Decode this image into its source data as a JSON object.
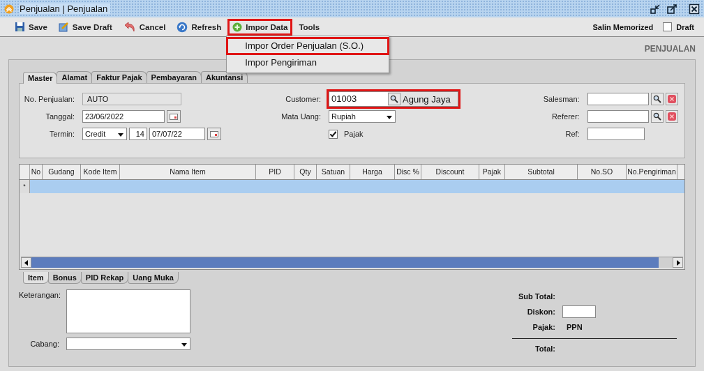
{
  "window": {
    "title": "Penjualan | Penjualan"
  },
  "toolbar": {
    "buttons": [
      {
        "kind": "save",
        "label": "Save",
        "highlighted": false
      },
      {
        "kind": "draft",
        "label": "Save Draft",
        "highlighted": false
      },
      {
        "kind": "cancel",
        "label": "Cancel",
        "highlighted": false
      },
      {
        "kind": "refresh",
        "label": "Refresh",
        "highlighted": false
      },
      {
        "kind": "import",
        "label": "Impor Data",
        "highlighted": true
      },
      {
        "kind": "plain",
        "label": "Tools",
        "highlighted": false
      }
    ],
    "memorized": "Salin Memorized",
    "draft": {
      "label": "Draft",
      "checked": false
    }
  },
  "menu": {
    "items": [
      {
        "label": "Impor Order Penjualan (S.O.)",
        "highlighted": true
      },
      {
        "label": "Impor Pengiriman",
        "highlighted": false
      }
    ]
  },
  "section_title": "PENJUALAN",
  "tabs": [
    {
      "label": "Master",
      "selected": true
    },
    {
      "label": "Alamat",
      "selected": false
    },
    {
      "label": "Faktur Pajak",
      "selected": false
    },
    {
      "label": "Pembayaran",
      "selected": false
    },
    {
      "label": "Akuntansi",
      "selected": false
    }
  ],
  "master": {
    "no_penjualan": {
      "label": "No. Penjualan:",
      "value": "AUTO"
    },
    "tanggal": {
      "label": "Tanggal:",
      "value": "23/06/2022"
    },
    "termin": {
      "label": "Termin:",
      "type": "Credit",
      "days": "14",
      "due": "07/07/22"
    },
    "customer": {
      "label": "Customer:",
      "code": "01003",
      "name": "Agung Jaya",
      "highlighted": true
    },
    "mata_uang": {
      "label": "Mata Uang:",
      "value": "Rupiah"
    },
    "pajak": {
      "label": "Pajak",
      "checked": true
    },
    "salesman": {
      "label": "Salesman:"
    },
    "referer": {
      "label": "Referer:"
    },
    "ref": {
      "label": "Ref:"
    }
  },
  "table": {
    "columns": [
      "No",
      "Gudang",
      "Kode Item",
      "Nama Item",
      "PID",
      "Qty",
      "Satuan",
      "Harga",
      "Disc %",
      "Discount",
      "Pajak",
      "Subtotal",
      "No.SO",
      "No.Pengiriman"
    ],
    "rows": [
      {
        "marker": "*",
        "selected": true
      }
    ]
  },
  "bottom_tabs": [
    {
      "label": "Item",
      "selected": true
    },
    {
      "label": "Bonus",
      "selected": false
    },
    {
      "label": "PID Rekap",
      "selected": false
    },
    {
      "label": "Uang Muka",
      "selected": false
    }
  ],
  "keterangan": {
    "label": "Keterangan:"
  },
  "cabang": {
    "label": "Cabang:"
  },
  "summary": {
    "sub_total": "Sub Total:",
    "diskon": "Diskon:",
    "pajak_label": "Pajak:",
    "pajak_value": "PPN",
    "total": "Total:"
  }
}
